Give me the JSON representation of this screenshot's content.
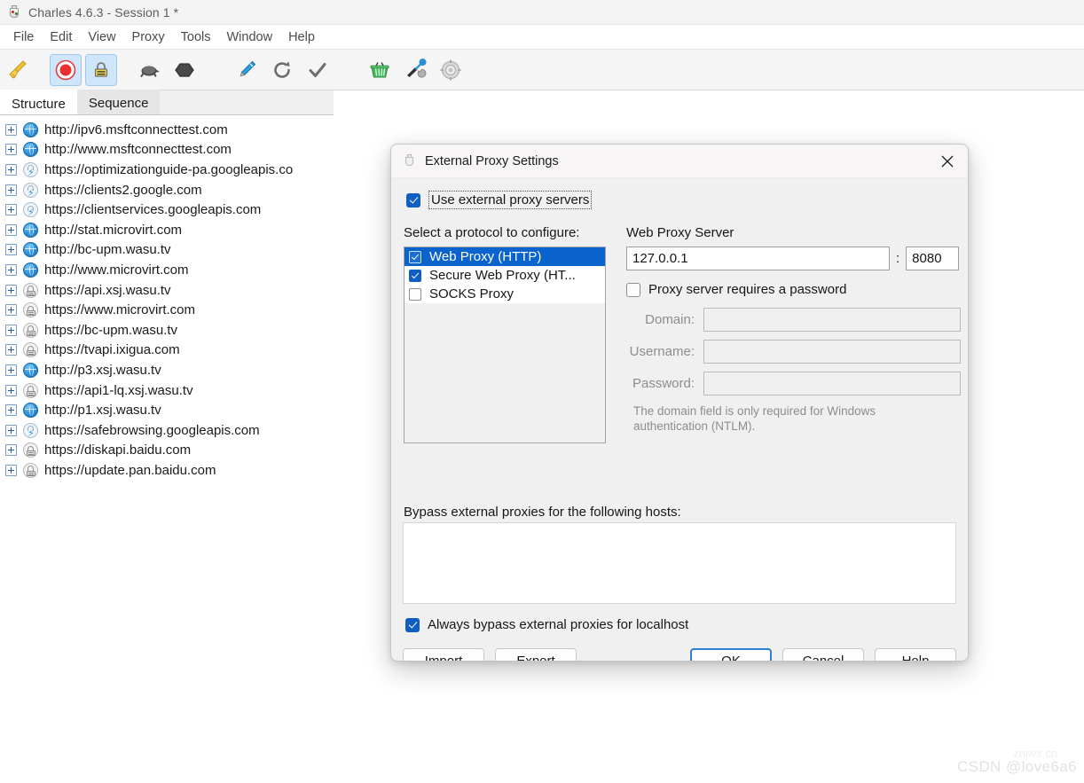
{
  "window": {
    "title": "Charles 4.6.3 - Session 1 *",
    "logo_icon": "charles-vase-icon"
  },
  "menubar": {
    "items": [
      {
        "label": "File"
      },
      {
        "label": "Edit"
      },
      {
        "label": "View"
      },
      {
        "label": "Proxy"
      },
      {
        "label": "Tools"
      },
      {
        "label": "Window"
      },
      {
        "label": "Help"
      }
    ]
  },
  "toolbar": {
    "buttons": [
      {
        "name": "clear-broom-icon",
        "glyph": "🧹",
        "active": false
      },
      {
        "name": "record-icon",
        "glyph": "⏺",
        "active": true
      },
      {
        "name": "ssl-proxying-icon",
        "glyph": "🔒",
        "active": true
      },
      {
        "name": "throttle-turtle-icon",
        "glyph": "🐢",
        "active": false
      },
      {
        "name": "breakpoints-hexagon-icon",
        "glyph": "⬢",
        "active": false
      },
      {
        "name": "compose-pen-icon",
        "glyph": "🖊",
        "active": false
      },
      {
        "name": "repeat-refresh-icon",
        "glyph": "⟳",
        "active": false
      },
      {
        "name": "validate-check-icon",
        "glyph": "✔",
        "active": false
      },
      {
        "name": "basket-icon",
        "glyph": "🧺",
        "active": false
      },
      {
        "name": "tools-icon",
        "glyph": "🛠",
        "active": false
      },
      {
        "name": "settings-gear-icon",
        "glyph": "⚙",
        "active": false
      }
    ]
  },
  "left_panel": {
    "tabs": [
      {
        "label": "Structure",
        "active": true
      },
      {
        "label": "Sequence",
        "active": false
      }
    ],
    "tree_items": [
      {
        "label": "http://ipv6.msftconnecttest.com",
        "icon": "globe-icon"
      },
      {
        "label": "http://www.msftconnecttest.com",
        "icon": "globe-icon"
      },
      {
        "label": "https://optimizationguide-pa.googleapis.co",
        "icon": "lock-bolt-icon"
      },
      {
        "label": "https://clients2.google.com",
        "icon": "lock-bolt-icon"
      },
      {
        "label": "https://clientservices.googleapis.com",
        "icon": "lock-bolt-icon"
      },
      {
        "label": "http://stat.microvirt.com",
        "icon": "globe-icon"
      },
      {
        "label": "http://bc-upm.wasu.tv",
        "icon": "globe-icon"
      },
      {
        "label": "http://www.microvirt.com",
        "icon": "globe-icon"
      },
      {
        "label": "https://api.xsj.wasu.tv",
        "icon": "lock-icon"
      },
      {
        "label": "https://www.microvirt.com",
        "icon": "lock-icon"
      },
      {
        "label": "https://bc-upm.wasu.tv",
        "icon": "lock-icon"
      },
      {
        "label": "https://tvapi.ixigua.com",
        "icon": "lock-icon"
      },
      {
        "label": "http://p3.xsj.wasu.tv",
        "icon": "globe-icon"
      },
      {
        "label": "https://api1-lq.xsj.wasu.tv",
        "icon": "lock-icon"
      },
      {
        "label": "http://p1.xsj.wasu.tv",
        "icon": "globe-icon"
      },
      {
        "label": "https://safebrowsing.googleapis.com",
        "icon": "lock-bolt-icon"
      },
      {
        "label": "https://diskapi.baidu.com",
        "icon": "lock-icon"
      },
      {
        "label": "https://update.pan.baidu.com",
        "icon": "lock-icon"
      }
    ]
  },
  "dialog": {
    "title": "External Proxy Settings",
    "close_icon": "close-icon",
    "use_external": {
      "label": "Use external proxy servers",
      "checked": true
    },
    "protocol_section": {
      "heading": "Select a protocol to configure:",
      "options": [
        {
          "label": "Web Proxy (HTTP)",
          "checked": true,
          "selected": true
        },
        {
          "label": "Secure Web Proxy (HT...",
          "checked": true,
          "selected": false
        },
        {
          "label": "SOCKS Proxy",
          "checked": false,
          "selected": false
        }
      ]
    },
    "server_section": {
      "heading": "Web Proxy Server",
      "host_value": "127.0.0.1",
      "host_placeholder": "",
      "separator": ":",
      "port_value": "8080",
      "port_placeholder": "",
      "requires_password": {
        "label": "Proxy server requires a password",
        "checked": false
      },
      "credentials": [
        {
          "label": "Domain:",
          "value": "",
          "placeholder": "",
          "disabled": true
        },
        {
          "label": "Username:",
          "value": "",
          "placeholder": "",
          "disabled": true
        },
        {
          "label": "Password:",
          "value": "",
          "placeholder": "",
          "disabled": true
        }
      ],
      "note": "The domain field is only required for Windows authentication (NTLM)."
    },
    "bypass": {
      "label": "Bypass external proxies for the following hosts:",
      "value": "",
      "placeholder": ""
    },
    "always_bypass": {
      "label": "Always bypass external proxies for localhost",
      "checked": true
    },
    "buttons": {
      "import": "Import",
      "export": "Export",
      "ok": "OK",
      "cancel": "Cancel",
      "help": "Help"
    }
  },
  "watermark": {
    "text": "CSDN @love6a6",
    "sub_text": "zniwx.cn"
  },
  "colors": {
    "accent_blue": "#0f5fc2",
    "selection_blue": "#0b63ce",
    "toolbar_active": "#cfe6fa",
    "dialog_bg": "#f0f0f0",
    "focus_border": "#2f7fd1"
  }
}
